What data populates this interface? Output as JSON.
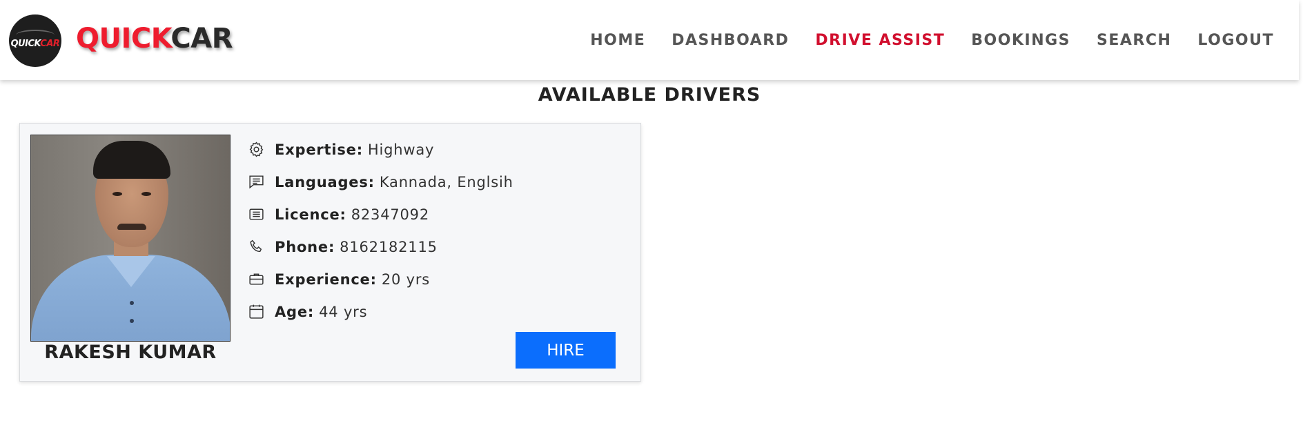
{
  "brand": {
    "logo_text_part1": "QUICK",
    "logo_text_part2": "CAR",
    "name_part1": "QUICK",
    "name_part2": "CAR"
  },
  "nav": {
    "items": [
      {
        "label": "HOME",
        "active": false
      },
      {
        "label": "DASHBOARD",
        "active": false
      },
      {
        "label": "DRIVE ASSIST",
        "active": true
      },
      {
        "label": "BOOKINGS",
        "active": false
      },
      {
        "label": "SEARCH",
        "active": false
      },
      {
        "label": "LOGOUT",
        "active": false
      }
    ],
    "active_color": "#d10f2e",
    "color": "#555555"
  },
  "page": {
    "title": "AVAILABLE DRIVERS"
  },
  "drivers": [
    {
      "name": "RAKESH KUMAR",
      "details": [
        {
          "icon": "gear-icon",
          "label": "Expertise:",
          "value": "Highway"
        },
        {
          "icon": "chat-icon",
          "label": "Languages:",
          "value": "Kannada, Englsih"
        },
        {
          "icon": "card-icon",
          "label": "Licence:",
          "value": "82347092"
        },
        {
          "icon": "phone-icon",
          "label": "Phone:",
          "value": "8162182115"
        },
        {
          "icon": "briefcase-icon",
          "label": "Experience:",
          "value": "20 yrs"
        },
        {
          "icon": "calendar-icon",
          "label": "Age:",
          "value": "44 yrs"
        }
      ],
      "hire_label": "HIRE"
    }
  ],
  "colors": {
    "brand_red": "#ee1c2e",
    "button_blue": "#0b6efd"
  }
}
